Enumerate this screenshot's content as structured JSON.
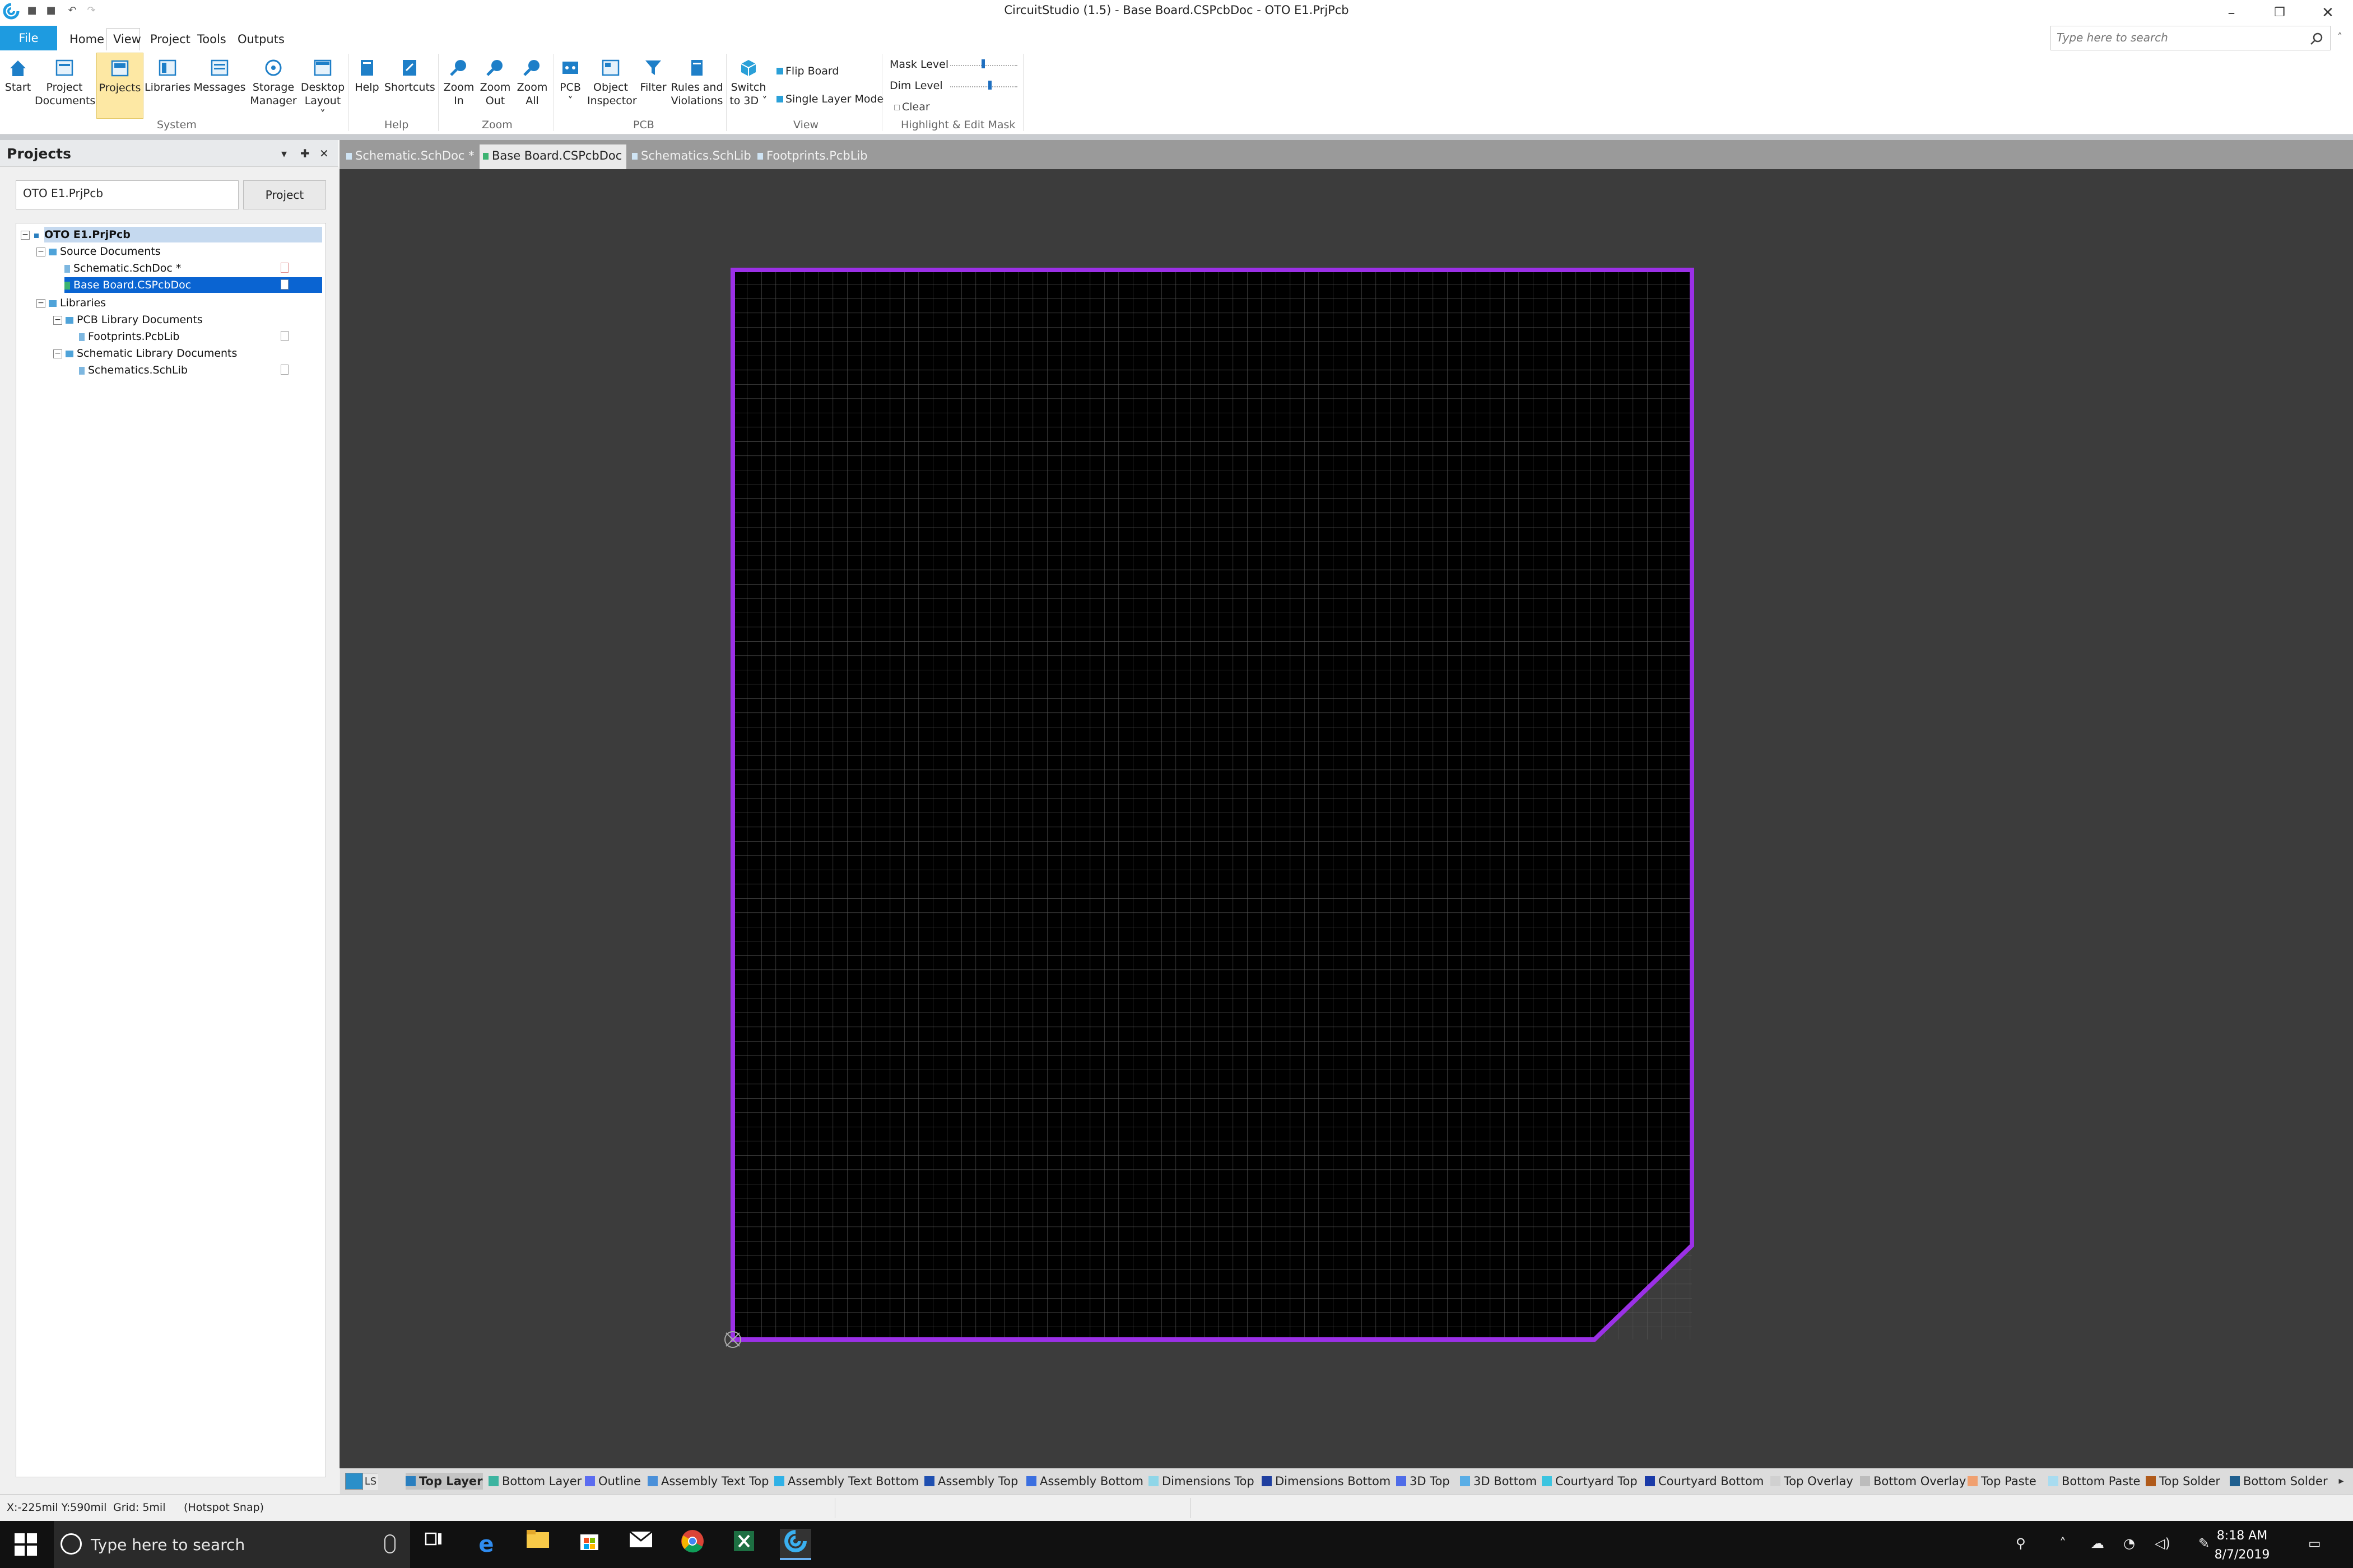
{
  "window": {
    "title": "CircuitStudio (1.5) - Base Board.CSPcbDoc - OTO E1.PrjPcb",
    "quick_access": [
      "save-icon",
      "save-all-icon",
      "undo-icon",
      "redo-icon"
    ]
  },
  "menu": {
    "file": "File",
    "items": [
      "Home",
      "View",
      "Project",
      "Tools",
      "Outputs"
    ],
    "search_placeholder": "Type here to search"
  },
  "ribbon": {
    "buttons": {
      "start": [
        "Start"
      ],
      "project_documents": [
        "Project",
        "Documents"
      ],
      "projects": [
        "Projects"
      ],
      "libraries": [
        "Libraries"
      ],
      "messages": [
        "Messages"
      ],
      "storage_manager": [
        "Storage",
        "Manager"
      ],
      "desktop_layout": [
        "Desktop",
        "Layout ˅"
      ],
      "help": [
        "Help"
      ],
      "shortcuts": [
        "Shortcuts"
      ],
      "zoom_in": [
        "Zoom",
        "In"
      ],
      "zoom_out": [
        "Zoom",
        "Out"
      ],
      "zoom_all": [
        "Zoom",
        "All"
      ],
      "pcb": [
        "PCB",
        "˅"
      ],
      "object_inspector": [
        "Object",
        "Inspector"
      ],
      "filter": [
        "Filter"
      ],
      "rules_violations": [
        "Rules and",
        "Violations"
      ],
      "switch_3d": [
        "Switch",
        "to 3D ˅"
      ]
    },
    "view_options": {
      "flip_board": "Flip Board",
      "single_layer_mode": "Single Layer Mode"
    },
    "mask": {
      "mask_level": "Mask Level",
      "dim_level": "Dim Level",
      "clear": "Clear"
    },
    "groups": {
      "system": "System",
      "help": "Help",
      "zoom": "Zoom",
      "pcb": "PCB",
      "view": "View",
      "highlight": "Highlight & Edit Mask"
    }
  },
  "panel": {
    "title": "Projects",
    "project_field": "OTO E1.PrjPcb",
    "project_button": "Project",
    "tree": {
      "root": "OTO E1.PrjPcb",
      "source_documents": "Source Documents",
      "schematic_doc": "Schematic.SchDoc *",
      "base_board": "Base Board.CSPcbDoc",
      "libraries": "Libraries",
      "pcb_library_documents": "PCB Library Documents",
      "footprints": "Footprints.PcbLib",
      "schematic_library_documents": "Schematic Library Documents",
      "schematics": "Schematics.SchLib"
    }
  },
  "doc_tabs": [
    "Schematic.SchDoc *",
    "Base Board.CSPcbDoc",
    "Schematics.SchLib",
    "Footprints.PcbLib"
  ],
  "active_tab": "Base Board.CSPcbDoc",
  "board": {
    "outline_color": "#9b30e6",
    "background_color": "#3c3c3c",
    "grid_color": "#555555"
  },
  "layers": {
    "ls_label": "LS",
    "items": [
      {
        "name": "Top Layer",
        "color": "#2a7fbf"
      },
      {
        "name": "Bottom Layer",
        "color": "#3cb4a0"
      },
      {
        "name": "Outline",
        "color": "#5b6cf0"
      },
      {
        "name": "Assembly Text Top",
        "color": "#4a90d9"
      },
      {
        "name": "Assembly Text Bottom",
        "color": "#2fb1e6"
      },
      {
        "name": "Assembly Top",
        "color": "#1f4fb0"
      },
      {
        "name": "Assembly Bottom",
        "color": "#3b6fe0"
      },
      {
        "name": "Dimensions Top",
        "color": "#8fd6e8"
      },
      {
        "name": "Dimensions Bottom",
        "color": "#1f3fa0"
      },
      {
        "name": "3D Top",
        "color": "#4f6ce8"
      },
      {
        "name": "3D Bottom",
        "color": "#5aaee6"
      },
      {
        "name": "Courtyard Top",
        "color": "#3bc4e0"
      },
      {
        "name": "Courtyard Bottom",
        "color": "#1a3aa8"
      },
      {
        "name": "Top Overlay",
        "color": "#d0d0d0"
      },
      {
        "name": "Bottom Overlay",
        "color": "#bcbcbc"
      },
      {
        "name": "Top Paste",
        "color": "#f0a070"
      },
      {
        "name": "Bottom Paste",
        "color": "#a8dcf0"
      },
      {
        "name": "Top Solder",
        "color": "#b05a1a"
      },
      {
        "name": "Bottom Solder",
        "color": "#1f5f8f"
      }
    ]
  },
  "status": {
    "coords": "X:-225mil Y:590mil",
    "grid": "Grid: 5mil",
    "snap": "(Hotspot Snap)"
  },
  "taskbar": {
    "search_text": "Type here to search",
    "time": "8:18 AM",
    "date": "8/7/2019"
  }
}
